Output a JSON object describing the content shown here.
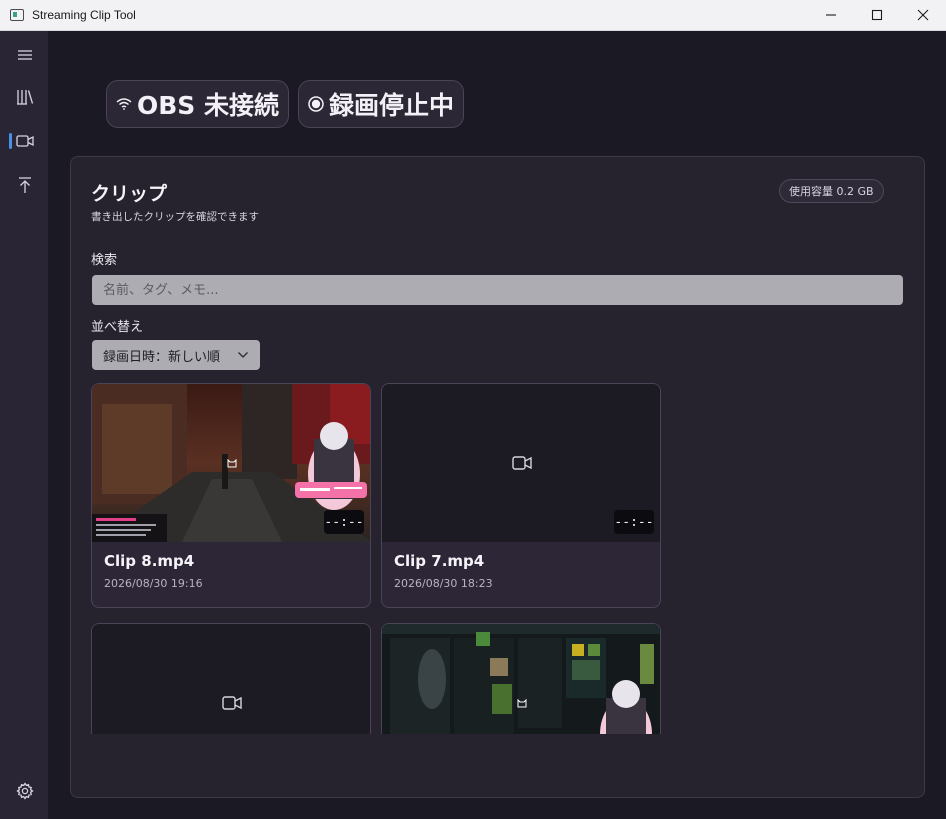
{
  "window": {
    "title": "Streaming Clip Tool"
  },
  "sidebar": {
    "items": [
      {
        "icon": "hamburger-menu-icon"
      },
      {
        "icon": "library-icon"
      },
      {
        "icon": "video-camera-icon",
        "selected": true
      },
      {
        "icon": "upload-icon"
      },
      {
        "icon": "settings-gear-icon"
      }
    ],
    "accent": "#4a8fe8"
  },
  "status": {
    "obs": "OBS 未接続",
    "recording": "録画停止中"
  },
  "clips_panel": {
    "title": "クリップ",
    "subtitle": "書き出したクリップを確認できます",
    "storage": "使用容量 0.2 GB",
    "search_label": "検索",
    "search_placeholder": "名前、タグ、メモ...",
    "sort_label": "並べ替え",
    "sort_value": "録画日時：新しい順"
  },
  "clips": [
    {
      "name": "Clip 8.mp4",
      "date": "2026/08/30 19:16",
      "duration": "--:--",
      "thumbnail": "game-city-street"
    },
    {
      "name": "Clip 7.mp4",
      "date": "2026/08/30 18:23",
      "duration": "--:--",
      "thumbnail": "video-camera-icon"
    },
    {
      "name": "",
      "date": "",
      "duration": "",
      "thumbnail": "video-camera-icon"
    },
    {
      "name": "",
      "date": "",
      "duration": "",
      "thumbnail": "game-inventory-screen"
    }
  ]
}
